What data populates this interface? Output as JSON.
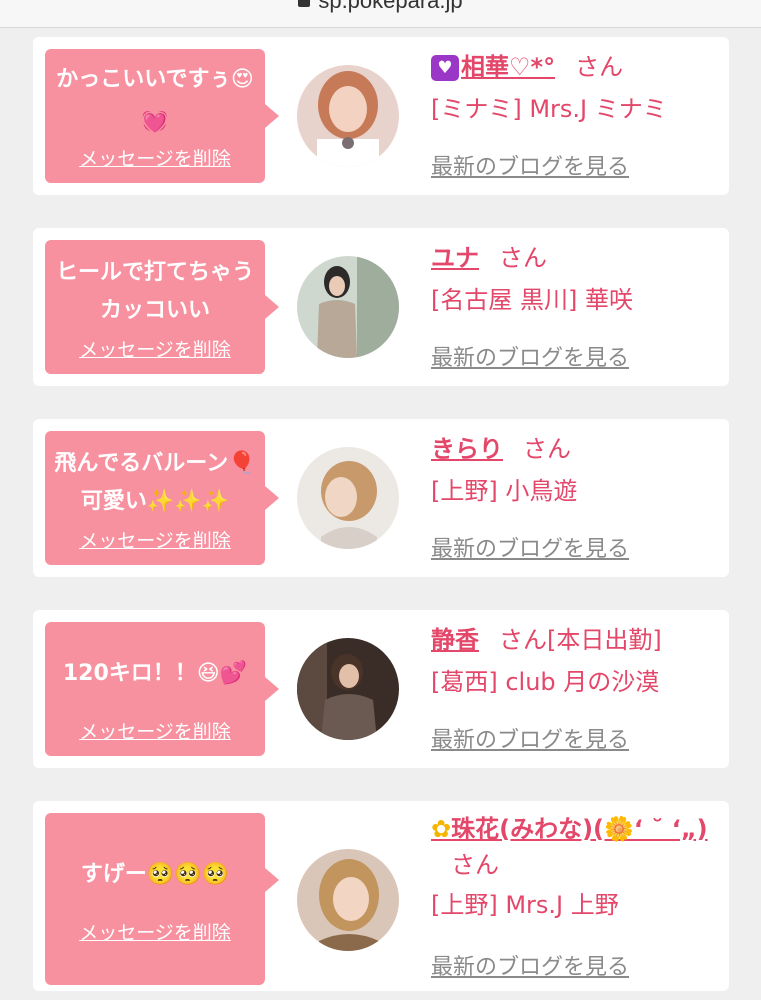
{
  "browser": {
    "url": "sp.pokepara.jp"
  },
  "common": {
    "delete_label": "メッセージを削除",
    "blog_label": "最新のブログを見る",
    "honorific": "さん"
  },
  "cards": [
    {
      "message": "かっこいいですぅ😍💓",
      "name": "相華♡*°",
      "name_icon": "purple-heart-box",
      "suffix": "",
      "shop": "[ミナミ] Mrs.J ミナミ"
    },
    {
      "message": "ヒールで打てちゃうカッコいい",
      "name": "ユナ",
      "suffix": "",
      "shop": "[名古屋 黒川] 華咲"
    },
    {
      "message": "飛んでるバルーン🎈可愛い✨✨✨",
      "name": "きらり",
      "suffix": "",
      "shop": "[上野] 小鳥遊"
    },
    {
      "message": "120キロ！！😆💕",
      "name": "静香",
      "suffix": "[本日出勤]",
      "shop": "[葛西] club 月の沙漠"
    },
    {
      "message": "すげー🥺🥺🥺",
      "name": "珠花(みわな)(🌼‘ ˘ ‘„)",
      "name_icon": "sunflower",
      "suffix": "",
      "shop": "[上野] Mrs.J 上野"
    }
  ],
  "colors": {
    "bubble": "#f8919f",
    "accent": "#e3476a",
    "link_gray": "#8a8a8a",
    "background": "#efefef"
  }
}
